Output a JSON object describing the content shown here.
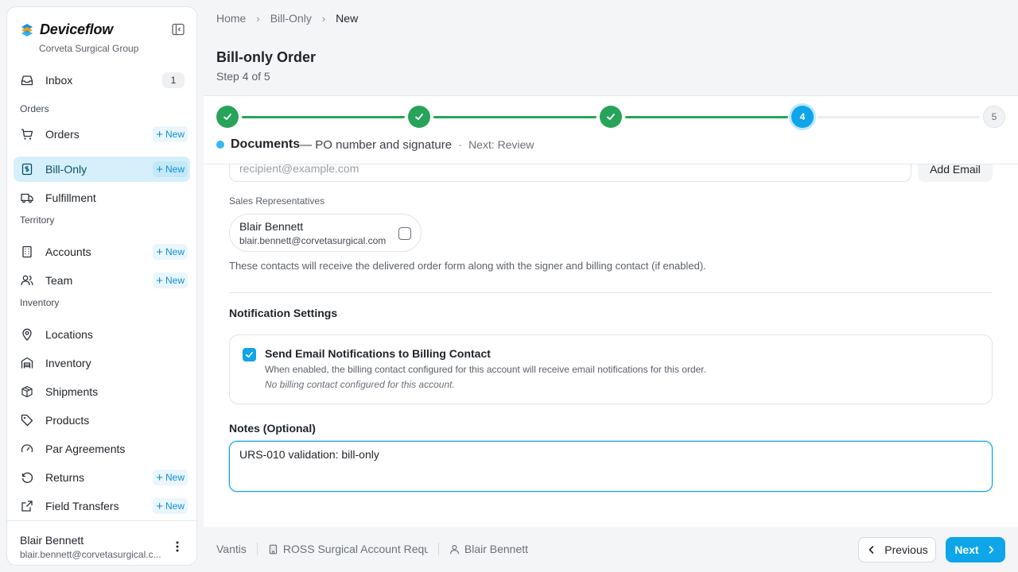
{
  "app": {
    "name": "Deviceflow",
    "org": "Corveta Surgical Group",
    "colors": {
      "accent": "#0ea5e9",
      "success": "#27a35a",
      "active_nav": "#d6f0fb"
    }
  },
  "sidebar": {
    "new_label": "New",
    "inbox": {
      "label": "Inbox",
      "count": "1",
      "icon": "inbox-icon"
    },
    "sections": {
      "orders": "Orders",
      "territory": "Territory",
      "inventory": "Inventory"
    },
    "items": [
      {
        "label": "Orders",
        "icon": "cart-icon",
        "has_new": true
      },
      {
        "label": "Bill-Only",
        "icon": "invoice-icon",
        "has_new": true,
        "active": true
      },
      {
        "label": "Fulfillment",
        "icon": "truck-icon",
        "has_new": false
      },
      {
        "label": "Accounts",
        "icon": "building-icon",
        "has_new": true
      },
      {
        "label": "Team",
        "icon": "users-icon",
        "has_new": true
      },
      {
        "label": "Locations",
        "icon": "map-pin-icon",
        "has_new": false
      },
      {
        "label": "Inventory",
        "icon": "warehouse-icon",
        "has_new": false
      },
      {
        "label": "Shipments",
        "icon": "package-icon",
        "has_new": false
      },
      {
        "label": "Products",
        "icon": "tag-icon",
        "has_new": false
      },
      {
        "label": "Par Agreements",
        "icon": "gauge-icon",
        "has_new": false
      },
      {
        "label": "Returns",
        "icon": "rotate-ccw-icon",
        "has_new": true
      },
      {
        "label": "Field Transfers",
        "icon": "transfer-icon",
        "has_new": true
      }
    ],
    "user": {
      "name": "Blair Bennett",
      "email": "blair.bennett@corvetasurgical.c..."
    }
  },
  "breadcrumb": [
    "Home",
    "Bill-Only",
    "New"
  ],
  "page": {
    "title": "Bill-only Order",
    "step_text": "Step 4 of 5"
  },
  "stepper": {
    "steps": [
      {
        "state": "done",
        "number": "1"
      },
      {
        "state": "done",
        "number": "2"
      },
      {
        "state": "done",
        "number": "3"
      },
      {
        "state": "current",
        "number": "4"
      },
      {
        "state": "future",
        "number": "5"
      }
    ],
    "current_name": "Documents",
    "current_desc": "— PO number and signature",
    "separator": "·",
    "next_text": "Next: Review"
  },
  "form": {
    "email_placeholder": "recipient@example.com",
    "add_email_label": "Add Email",
    "sales_reps_label": "Sales Representatives",
    "rep": {
      "name": "Blair Bennett",
      "email": "blair.bennett@corvetasurgical.com",
      "checked": false
    },
    "help_text": "These contacts will receive the delivered order form along with the signer and billing contact (if enabled).",
    "notification_title": "Notification Settings",
    "notification": {
      "checked": true,
      "title": "Send Email Notifications to Billing Contact",
      "desc": "When enabled, the billing contact configured for this account will receive email notifications for this order.",
      "note": "No billing contact configured for this account."
    },
    "notes_label": "Notes (Optional)",
    "notes_value": "URS-010 validation: bill-only"
  },
  "footer": {
    "vendor": "Vantis",
    "account": "ROSS Surgical Account Requ",
    "user": "Blair Bennett",
    "prev_label": "Previous",
    "next_label": "Next"
  }
}
